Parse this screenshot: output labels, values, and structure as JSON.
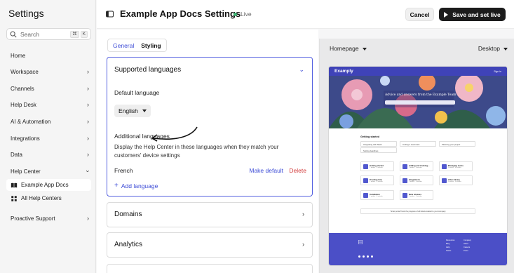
{
  "sidebar": {
    "title": "Settings",
    "search": {
      "placeholder": "Search",
      "shortcut": [
        "⌘",
        "K"
      ]
    },
    "items": [
      {
        "label": "Home",
        "chevron": false
      },
      {
        "label": "Workspace",
        "chevron": true
      },
      {
        "label": "Channels",
        "chevron": true
      },
      {
        "label": "Help Desk",
        "chevron": true
      },
      {
        "label": "AI & Automation",
        "chevron": true
      },
      {
        "label": "Integrations",
        "chevron": true
      },
      {
        "label": "Data",
        "chevron": true
      },
      {
        "label": "Help Center",
        "chevron": true,
        "expanded": true
      },
      {
        "label": "Proactive Support",
        "chevron": true
      }
    ],
    "help_center_children": [
      {
        "label": "Example App Docs",
        "icon": "book-icon",
        "active": true
      },
      {
        "label": "All Help Centers",
        "icon": "grid-icon",
        "active": false
      }
    ]
  },
  "header": {
    "title": "Example App Docs Settings",
    "status": "Live",
    "status_color": "#3cb371",
    "cancel_label": "Cancel",
    "save_label": "Save and set live"
  },
  "tabs": [
    {
      "label": "General",
      "active": true
    },
    {
      "label": "Styling",
      "active": false
    }
  ],
  "supported_languages": {
    "title": "Supported languages",
    "default_language_label": "Default language",
    "default_language_value": "English",
    "additional_label": "Additional languages",
    "description": "Display the Help Center in these languages when they match your customers' device settings",
    "languages": [
      {
        "name": "French",
        "make_default": "Make default",
        "delete": "Delete"
      }
    ],
    "add_language": "Add language"
  },
  "sections": [
    {
      "title": "Domains"
    },
    {
      "title": "Analytics"
    }
  ],
  "preview": {
    "page_select": "Homepage",
    "device_select": "Desktop",
    "site": {
      "logo": "Examply",
      "signin": "Sign in",
      "hero_heading": "Advice and answers from the Example Team",
      "section_title": "Getting started",
      "quick_links": [
        "Integrating with Slack",
        "Inviting a teammate",
        "Planning your project",
        "Setting deadlines"
      ],
      "topics": [
        {
          "title": "Getting started",
          "sub": "1 author · 5 articles"
        },
        {
          "title": "Adding and tracking...",
          "sub": "1 author · 6 articles"
        },
        {
          "title": "Managing teams",
          "sub": "1 author · 6 articles"
        },
        {
          "title": "Tracking time",
          "sub": "1 author · 4 articles"
        },
        {
          "title": "Integrations",
          "sub": "1 author · 5 articles"
        },
        {
          "title": "Video library",
          "sub": "1 author · 3 articles"
        },
        {
          "title": "Installation",
          "sub": "1 author · 4 articles"
        },
        {
          "title": "Beta releases",
          "sub": "1 author · 2 articles"
        }
      ],
      "ticket_text": "Ticket portal  Track the progress of all tickets related to your company",
      "footer_cols": [
        [
          "Resources",
          "Blog",
          "Help",
          "Status"
        ],
        [
          "Company",
          "About",
          "Careers",
          "Press"
        ]
      ],
      "brand_color": "#4b4fc7"
    }
  },
  "colors": {
    "accent": "#3c4bd6",
    "danger": "#d23b3b"
  }
}
